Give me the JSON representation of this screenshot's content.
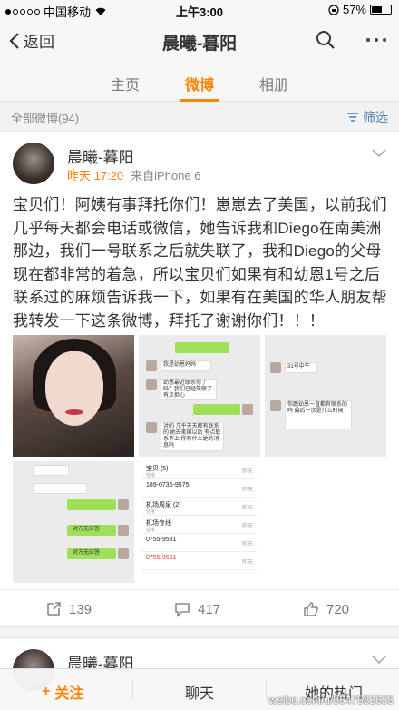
{
  "status_bar": {
    "carrier": "中国移动",
    "time": "上午3:00",
    "battery": "57%",
    "battery_level": 0.57
  },
  "nav": {
    "back_label": "返回",
    "title": "晨曦-暮阳"
  },
  "tabs": [
    {
      "label": "主页",
      "active": false
    },
    {
      "label": "微博",
      "active": true
    },
    {
      "label": "相册",
      "active": false
    }
  ],
  "count_bar": {
    "count_label": "全部微博(94)",
    "filter_label": "筛选"
  },
  "post": {
    "author": "晨曦-暮阳",
    "time": "昨天 17:20",
    "source": "来自iPhone 6",
    "text": "宝贝们！阿姨有事拜托你们！崽崽去了美国，以前我们几乎每天都会电话或微信，她告诉我和Diego在南美洲那边，我们一号联系之后就失联了，我和Diego的父母现在都非常的着急，所以宝贝们如果有和幼恩1号之后联系过的麻烦告诉我一下，如果有在美国的华人朋友帮我转发一下这条微博，拜托了谢谢你们！！！",
    "images": {
      "chat1_msg1": "我是幼恩妈妈",
      "chat1_msg2": "幼恩最近联系你了吗？我们已经失联了 有点担心",
      "chat1_msg3": "对的 几乎天天都有联系的 她去美国以后 有点联系不上 你有什么她的消息吗",
      "chat2_msg1": "31号中午",
      "chat2_msg2": "你跟幼恩一直都有联系的吗 最后一次是什么时候",
      "chat3_msg1": "对方无应答",
      "chat3_msg2": "对方无应答",
      "call_list": [
        {
          "name": "宝贝 (5)",
          "sub": "住宅",
          "right": "昨天"
        },
        {
          "name": "189-0736-9575",
          "sub": "",
          "right": "昨天"
        },
        {
          "name": "机场周泉 (2)",
          "sub": "住宅",
          "right": "昨天"
        },
        {
          "name": "机场专线",
          "sub": "住宅",
          "right": "昨天"
        },
        {
          "name": "0755-9581",
          "sub": "",
          "right": "昨天"
        },
        {
          "name": "0755-9581",
          "sub": "",
          "right": "昨天"
        }
      ]
    },
    "actions": {
      "repost_count": "139",
      "comment_count": "417",
      "like_count": "720"
    }
  },
  "post2": {
    "author": "晨曦-暮阳"
  },
  "bottom_bar": {
    "follow_label": "关注",
    "chat_label": "聊天",
    "hot_label": "她的热门"
  },
  "watermark": "weibo.com/u/5647583655",
  "colors": {
    "accent": "#ff8200",
    "link": "#4a7fb5"
  }
}
